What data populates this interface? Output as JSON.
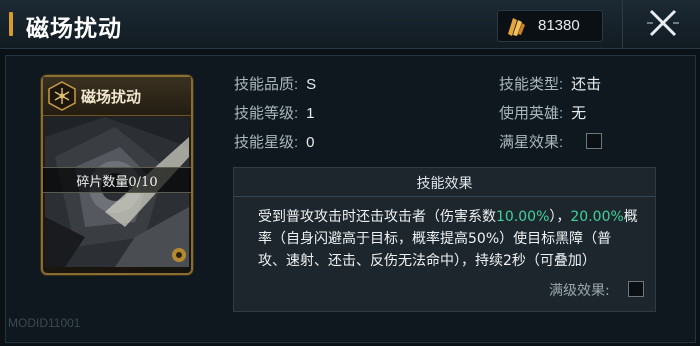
{
  "header": {
    "title": "磁场扰动",
    "currency": {
      "icon": "crystal-icon",
      "value": "81380"
    },
    "close_icon": "close-icon"
  },
  "card": {
    "title": "磁场扰动",
    "fragments": "碎片数量0/10",
    "id_text": "MODID11001"
  },
  "attributes": {
    "quality_label": "技能品质:",
    "quality_value": "S",
    "level_label": "技能等级:",
    "level_value": "1",
    "star_label": "技能星级:",
    "star_value": "0",
    "type_label": "技能类型:",
    "type_value": "还击",
    "hero_label": "使用英雄:",
    "hero_value": "无",
    "max_star_label": "满星效果:"
  },
  "effects": {
    "title": "技能效果",
    "text_a": "受到普攻攻击时还击攻击者（伤害系数",
    "pct_a": "10.00%",
    "text_b": "），",
    "pct_b": "20.00%",
    "text_c": "概率（自身闪避高于目标，概率提高50%）使目标黑障（普攻、速射、还击、反伤无法命中），持续2秒（可叠加）",
    "max_level_label": "满级效果:"
  },
  "colors": {
    "accent_gold": "#d89a2b",
    "highlight_green": "#3fd29a"
  }
}
